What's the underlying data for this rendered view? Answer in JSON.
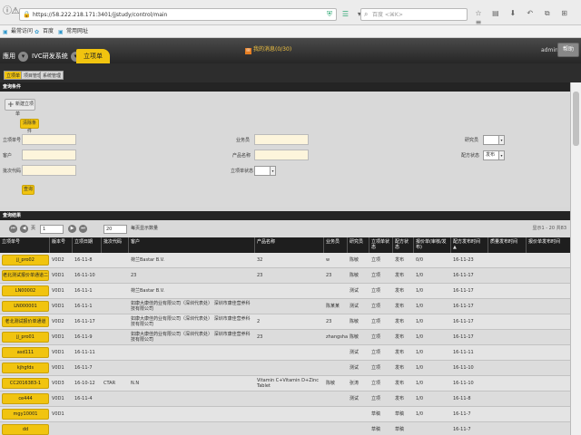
{
  "browser": {
    "url": "https://58.222.218.171:3401/jjstudy/control/main",
    "search_placeholder": "百度 <⌘K>",
    "bookmarks": [
      "最常访问",
      "百度",
      "常用网址"
    ]
  },
  "header": {
    "tabs": [
      "應用",
      "IVC研发系统",
      "立项单"
    ],
    "message": "我的消息(0/30)",
    "user": "admin",
    "help": "帮助"
  },
  "subtabs": [
    "立项单",
    "项目管理",
    "系统管理"
  ],
  "query": {
    "title": "查询条件",
    "new_button": "新建立项单",
    "clear_button": "清除条件",
    "labels": {
      "order_no": "立项单号",
      "customer": "客户",
      "batch": "批次代码",
      "salesman": "业务员",
      "product": "产品名称",
      "status": "立项单状态",
      "researcher": "研究员",
      "formula_status": "配方状态"
    },
    "formula_status_value": "发布",
    "query_button": "查询"
  },
  "results": {
    "title": "查询结果",
    "page_label": "页",
    "page_value": "1",
    "page_size": "20",
    "page_size_label": "每页显示数量",
    "info": "显示1 - 20 共83"
  },
  "columns": [
    "立项单号",
    "版本号",
    "立项日期",
    "批次代码",
    "客户",
    "产品名称",
    "业务员",
    "研究员",
    "立项单状态",
    "配方状态",
    "报价单(审核/发布)",
    "配方发布时间",
    "质量发布时间",
    "报价单发布时间"
  ],
  "rows": [
    {
      "id": "jj_pro02",
      "ver": "V0D2",
      "date": "16-11-8",
      "batch": "",
      "customer": "荷兰Bastar B.V.",
      "product": "32",
      "sales": "w",
      "research": "陈敏",
      "status": "立项",
      "formula": "发布",
      "quote": "0/0",
      "ftime": "16-11-23"
    },
    {
      "id": "老北测试报价单通道二",
      "ver": "V0D1",
      "date": "16-11-10",
      "batch": "",
      "customer": "23",
      "product": "23",
      "sales": "23",
      "research": "陈敏",
      "status": "立项",
      "formula": "发布",
      "quote": "1/0",
      "ftime": "16-11-17"
    },
    {
      "id": "LN00002",
      "ver": "V0D1",
      "date": "16-11-1",
      "batch": "",
      "customer": "荷兰Bastar B.V.",
      "product": "",
      "sales": "",
      "research": "测试",
      "status": "立项",
      "formula": "发布",
      "quote": "1/0",
      "ftime": "16-11-17"
    },
    {
      "id": "LN000001",
      "ver": "V0D1",
      "date": "16-11-1",
      "batch": "",
      "customer": "如康大康佳药业有限公司（深圳代表处） 深圳市康佳营养科技有限公司",
      "product": "",
      "sales": "陈某某",
      "research": "测试",
      "status": "立项",
      "formula": "发布",
      "quote": "1/0",
      "ftime": "16-11-17"
    },
    {
      "id": "老北测试报价单通道",
      "ver": "V0D2",
      "date": "16-11-17",
      "batch": "",
      "customer": "如康大康佳药业有限公司（深圳代表处） 深圳市康佳营养科技有限公司",
      "product": "2",
      "sales": "23",
      "research": "陈敏",
      "status": "立项",
      "formula": "发布",
      "quote": "1/0",
      "ftime": "16-11-17"
    },
    {
      "id": "jj_pro01",
      "ver": "V0D1",
      "date": "16-11-9",
      "batch": "",
      "customer": "如康大康佳药业有限公司（深圳代表处） 深圳市康佳营养科技有限公司",
      "product": "23",
      "sales": "zhangshan",
      "research": "陈敏",
      "status": "立项",
      "formula": "发布",
      "quote": "1/0",
      "ftime": "16-11-17"
    },
    {
      "id": "asd111",
      "ver": "V0D1",
      "date": "16-11-11",
      "batch": "",
      "customer": "",
      "product": "",
      "sales": "",
      "research": "测试",
      "status": "立项",
      "formula": "发布",
      "quote": "1/0",
      "ftime": "16-11-11"
    },
    {
      "id": "kjhgfds",
      "ver": "V0D1",
      "date": "16-11-7",
      "batch": "",
      "customer": "",
      "product": "",
      "sales": "",
      "research": "测试",
      "status": "立项",
      "formula": "发布",
      "quote": "1/0",
      "ftime": "16-11-10"
    },
    {
      "id": "CC2016383-1",
      "ver": "V0D3",
      "date": "16-10-12",
      "batch": "CTAR",
      "customer": "N.N",
      "product": "Vitamin C+Vitamin D+Zinc Tablet",
      "sales": "陈敏",
      "research": "张涛",
      "status": "立项",
      "formula": "发布",
      "quote": "1/0",
      "ftime": "16-11-10"
    },
    {
      "id": "ce444",
      "ver": "V0D1",
      "date": "16-11-4",
      "batch": "",
      "customer": "",
      "product": "",
      "sales": "",
      "research": "测试",
      "status": "立项",
      "formula": "发布",
      "quote": "1/0",
      "ftime": "16-11-8"
    },
    {
      "id": "mgy10001",
      "ver": "V0D1",
      "date": "",
      "batch": "",
      "customer": "",
      "product": "",
      "sales": "",
      "research": "",
      "status": "草稿",
      "formula": "草稿",
      "quote": "1/0",
      "ftime": "16-11-7"
    },
    {
      "id": "dd",
      "ver": "",
      "date": "",
      "batch": "",
      "customer": "",
      "product": "",
      "sales": "",
      "research": "",
      "status": "草稿",
      "formula": "草稿",
      "quote": "",
      "ftime": "16-11-7"
    }
  ]
}
